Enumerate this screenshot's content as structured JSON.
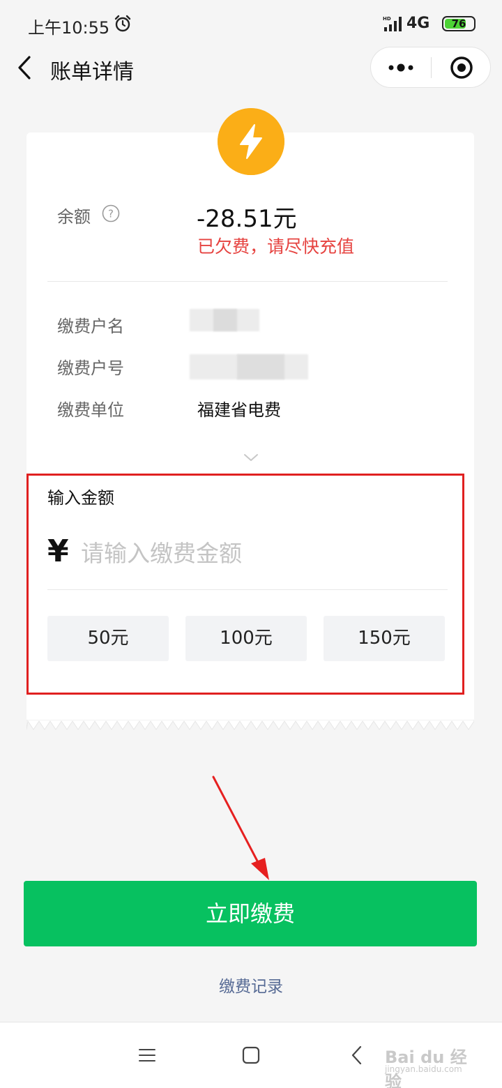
{
  "status_bar": {
    "time": "上午10:55",
    "network": "4G",
    "signal_tag": "HD",
    "battery": "76",
    "battery_level": 0.76
  },
  "nav": {
    "title": "账单详情"
  },
  "card": {
    "balance_label": "余额",
    "balance_value": "-28.51元",
    "arrears_note": "已欠费，请尽快充值",
    "rows": [
      {
        "label": "缴费户名",
        "value": ""
      },
      {
        "label": "缴费户号",
        "value": ""
      },
      {
        "label": "缴费单位",
        "value": "福建省电费"
      }
    ]
  },
  "amount": {
    "title": "输入金额",
    "currency_symbol": "¥",
    "placeholder": "请输入缴费金额",
    "presets": [
      "50元",
      "100元",
      "150元"
    ]
  },
  "actions": {
    "pay_label": "立即缴费",
    "history_label": "缴费记录"
  },
  "watermark": {
    "brand": "Bai du 经验",
    "url": "jingyan.baidu.com"
  },
  "colors": {
    "accent_green": "#07c160",
    "warning_red": "#e64340",
    "badge_orange": "#fbae17",
    "link_blue": "#576b95"
  },
  "icons": {
    "badge": "lightning-bolt-icon",
    "help": "question-circle-icon",
    "expand": "chevron-down-icon"
  }
}
